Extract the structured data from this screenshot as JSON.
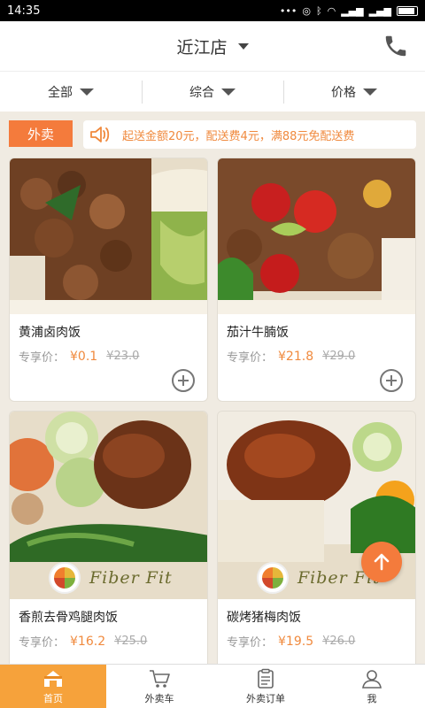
{
  "status_bar": {
    "time": "14:35"
  },
  "header": {
    "store_name": "近江店",
    "icons": [
      "chevron-down-icon",
      "phone-icon"
    ]
  },
  "filters": [
    {
      "label": "全部"
    },
    {
      "label": "综合"
    },
    {
      "label": "价格"
    }
  ],
  "notice": {
    "tag": "外卖",
    "text": "起送金额20元，配送费4元，满88元免配送费"
  },
  "products": [
    {
      "name": "黄浦卤肉饭",
      "price_label": "专享价：",
      "price": "¥0.1",
      "original": "¥23.0",
      "brand": ""
    },
    {
      "name": "茄汁牛腩饭",
      "price_label": "专享价：",
      "price": "¥21.8",
      "original": "¥29.0",
      "brand": ""
    },
    {
      "name": "香煎去骨鸡腿肉饭",
      "price_label": "专享价：",
      "price": "¥16.2",
      "original": "¥25.0",
      "brand": "Fiber Fit"
    },
    {
      "name": "碳烤猪梅肉饭",
      "price_label": "专享价：",
      "price": "¥19.5",
      "original": "¥26.0",
      "brand": "Fiber Fit"
    }
  ],
  "tabbar": [
    {
      "label": "首页",
      "icon": "home-icon",
      "active": true
    },
    {
      "label": "外卖车",
      "icon": "cart-icon"
    },
    {
      "label": "外卖订单",
      "icon": "orders-icon"
    },
    {
      "label": "我",
      "icon": "profile-icon"
    }
  ],
  "colors": {
    "accent": "#f47b3c",
    "price": "#f08a3e",
    "tab_active": "#f6a23b"
  }
}
